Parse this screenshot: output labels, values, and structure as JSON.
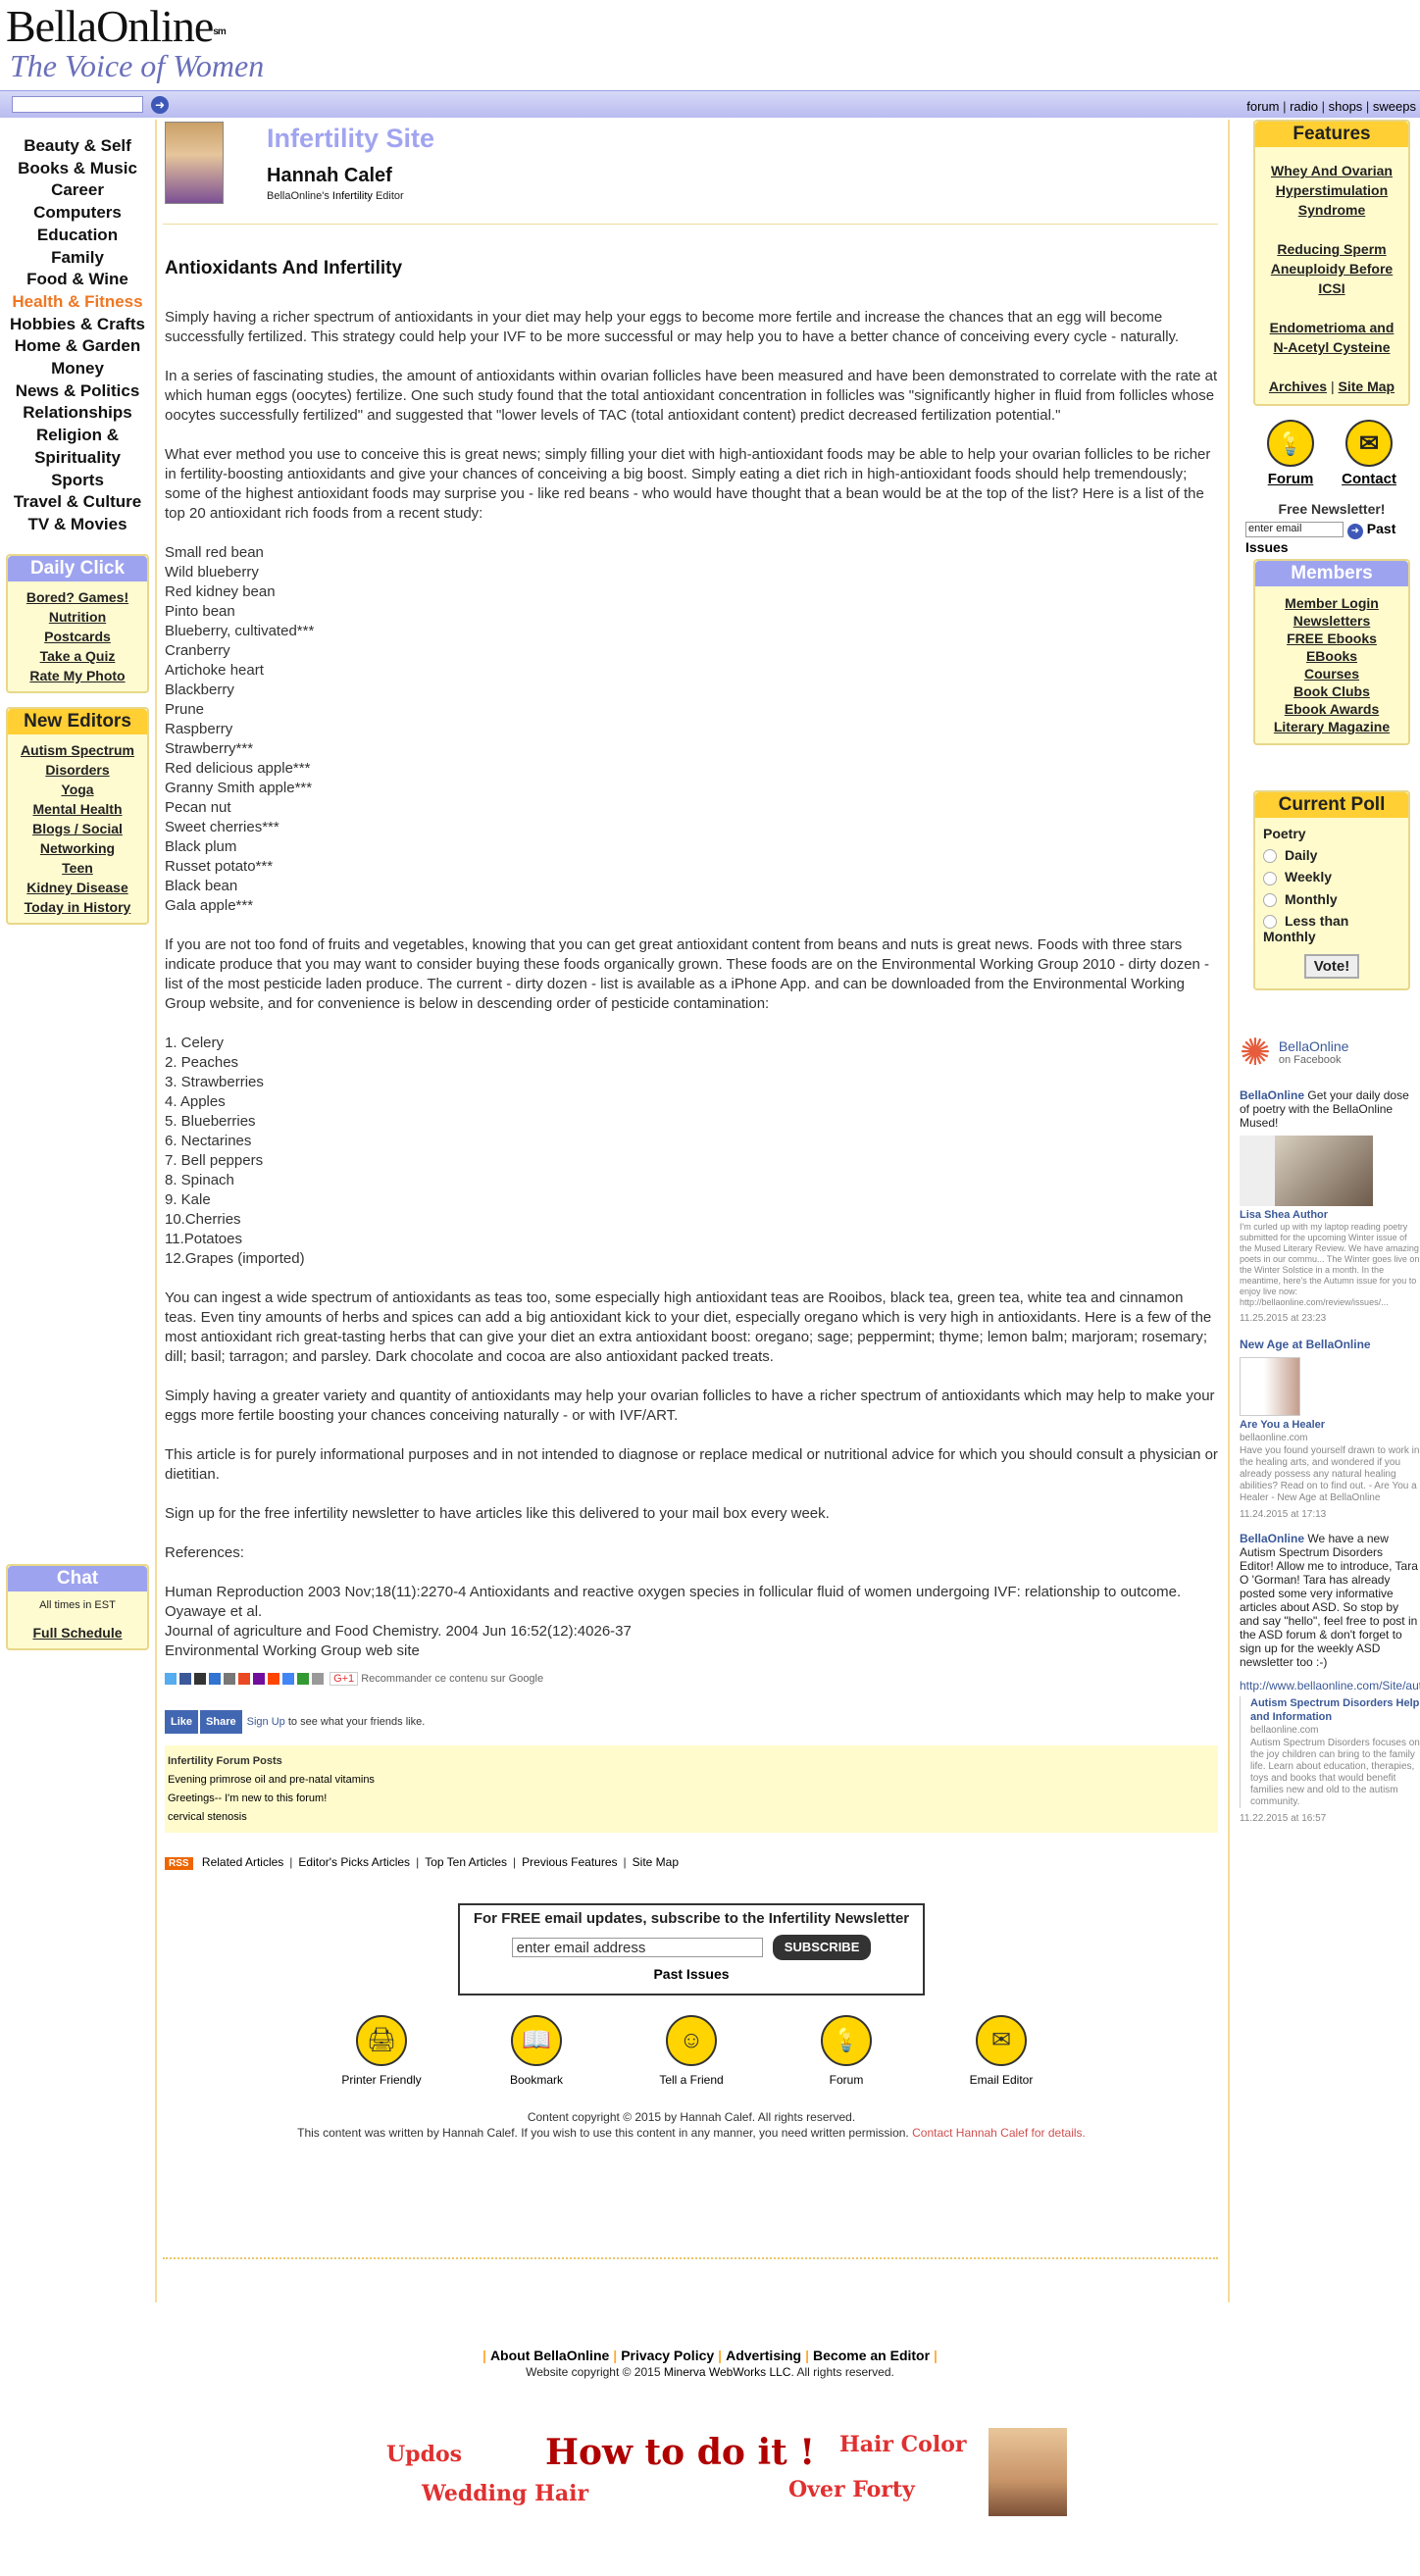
{
  "logo": {
    "name": "BellaOnline",
    "sm": "sm",
    "tagline": "The Voice of Women"
  },
  "topbar": {
    "links": [
      "forum",
      "radio",
      "shops",
      "sweeps"
    ]
  },
  "categories": [
    "Beauty & Self",
    "Books & Music",
    "Career",
    "Computers",
    "Education",
    "Family",
    "Food & Wine",
    "Health & Fitness",
    "Hobbies & Crafts",
    "Home & Garden",
    "Money",
    "News & Politics",
    "Relationships",
    "Religion &",
    "Spirituality",
    "Sports",
    "Travel & Culture",
    "TV & Movies"
  ],
  "daily_click": {
    "title": "Daily Click",
    "items": [
      "Bored? Games!",
      "Nutrition",
      "Postcards",
      "Take a Quiz",
      "Rate My Photo"
    ]
  },
  "new_editors": {
    "title": "New Editors",
    "items": [
      "Autism Spectrum",
      "Disorders",
      "Yoga",
      "Mental Health",
      "Blogs / Social",
      "Networking",
      "Teen",
      "Kidney Disease",
      "Today in History"
    ]
  },
  "chat": {
    "title": "Chat",
    "line": "All times in EST",
    "link": "Full Schedule"
  },
  "header": {
    "site": "Infertility Site",
    "name": "Hannah Calef",
    "ed_pre": "BellaOnline's",
    "ed_link": "Infertility",
    "ed_post": "Editor"
  },
  "article": {
    "title": "Antioxidants And Infertility",
    "p1": "Simply having a richer spectrum of antioxidants in your diet may help your eggs to become more fertile and increase the chances that an egg will become successfully fertilized. This strategy could help your IVF to be more successful or may help you to have a better chance of conceiving every cycle - naturally.",
    "p2": "In a series of fascinating studies, the amount of antioxidants within ovarian follicles have been measured and have been demonstrated to correlate with the rate at which human eggs (oocytes) fertilize. One such study found that the total antioxidant concentration in follicles was \"significantly higher in fluid from follicles whose oocytes successfully fertilized\" and suggested that \"lower levels of TAC (total antioxidant content) predict decreased fertilization potential.\"",
    "p3": "What ever method you use to conceive this is great news; simply filling your diet with high-antioxidant foods may be able to help your ovarian follicles to be richer in fertility-boosting antioxidants and give your chances of conceiving a big boost. Simply eating a diet rich in high-antioxidant foods should help tremendously; some of the highest antioxidant foods may surprise you - like red beans - who would have thought that a bean would be at the top of the list? Here is a list of the top 20 antioxidant rich foods from a recent study:",
    "foods": [
      "Small red bean",
      "Wild blueberry",
      "Red kidney bean",
      "Pinto bean",
      "Blueberry, cultivated***",
      "Cranberry",
      "Artichoke heart",
      "Blackberry",
      "Prune",
      "Raspberry",
      "Strawberry***",
      "Red delicious apple***",
      "Granny Smith apple***",
      "Pecan nut",
      "Sweet cherries***",
      "Black plum",
      "Russet potato***",
      "Black bean",
      "Gala apple***"
    ],
    "p4": "If you are not too fond of fruits and vegetables, knowing that you can get great antioxidant content from beans and nuts is great news. Foods with three stars indicate produce that you may want to consider buying these foods organically grown. These foods are on the Environmental Working Group 2010 - dirty dozen - list of the most pesticide laden produce. The current - dirty dozen - list is available as a iPhone App. and can be downloaded from the Environmental Working Group website, and for convenience is below in descending order of pesticide contamination:",
    "dozen": [
      "1. Celery",
      "2. Peaches",
      "3. Strawberries",
      "4. Apples",
      "5. Blueberries",
      "6. Nectarines",
      "7. Bell peppers",
      "8. Spinach",
      "9. Kale",
      "10.Cherries",
      "11.Potatoes",
      "12.Grapes (imported)"
    ],
    "p5": "You can ingest a wide spectrum of antioxidants as teas too, some especially high antioxidant teas are Rooibos, black tea, green tea, white tea and cinnamon teas. Even tiny amounts of herbs and spices can add a big antioxidant kick to your diet, especially oregano which is very high in antioxidants. Here is a few of the most antioxidant rich great-tasting herbs that can give your diet an extra antioxidant boost: oregano; sage; peppermint; thyme; lemon balm; marjoram; rosemary; dill; basil; tarragon; and parsley. Dark chocolate and cocoa are also antioxidant packed treats.",
    "p6": "Simply having a greater variety and quantity of antioxidants may help your ovarian follicles to have a richer spectrum of antioxidants which may help to make your eggs more fertile boosting your chances conceiving naturally - or with IVF/ART.",
    "p7": "This article is for purely informational purposes and in not intended to diagnose or replace medical or nutritional advice for which you should consult a physician or dietitian.",
    "p8": "Sign up for the free infertility newsletter to have articles like this delivered to your mail box every week.",
    "refs_title": "References:",
    "ref1": "Human Reproduction 2003 Nov;18(11):2270-4 Antioxidants and reactive oxygen species in follicular fluid of women undergoing IVF: relationship to outcome. Oyawaye et al.",
    "ref2": "Journal of agriculture and Food Chemistry. 2004 Jun 16:52(12):4026-37",
    "ref3": "Environmental Working Group web site"
  },
  "social": {
    "gplus": "G+1",
    "recommend": "Recommander ce contenu sur Google",
    "like": "Like",
    "share": "Share",
    "signup": "Sign Up",
    "signup_rest": "to see what your friends like."
  },
  "forum_posts": {
    "title": "Infertility Forum Posts",
    "items": [
      "Evening primrose oil and pre-natal vitamins",
      "Greetings-- I'm new to this forum!",
      "cervical stenosis"
    ]
  },
  "links_row": {
    "rss": "RSS",
    "items": [
      "Related Articles",
      "Editor's Picks Articles",
      "Top Ten Articles",
      "Previous Features",
      "Site Map"
    ]
  },
  "newsletter": {
    "title": "For FREE email updates, subscribe to the Infertility Newsletter",
    "placeholder": "enter email address",
    "button": "SUBSCRIBE",
    "past": "Past Issues"
  },
  "bottom_icons": [
    "Printer Friendly",
    "Bookmark",
    "Tell a Friend",
    "Forum",
    "Email Editor"
  ],
  "copyright": {
    "line1": "Content copyright © 2015 by Hannah Calef. All rights reserved.",
    "line2": "This content was written by Hannah Calef. If you wish to use this content in any manner, you need written permission.",
    "link": "Contact Hannah Calef for details."
  },
  "features": {
    "title": "Features",
    "items": [
      "Whey And Ovarian Hyperstimulation Syndrome",
      "Reducing Sperm Aneuploidy Before ICSI",
      "Endometrioma and N-Acetyl Cysteine"
    ],
    "archives": "Archives",
    "sitemap": "Site Map"
  },
  "right_icons": {
    "forum": "Forum",
    "contact": "Contact"
  },
  "right_newsletter": {
    "title": "Free Newsletter!",
    "placeholder": "enter email",
    "past": "Past Issues"
  },
  "members": {
    "title": "Members",
    "items": [
      "Member Login",
      "Newsletters",
      "FREE Ebooks",
      "EBooks",
      "Courses",
      "Book Clubs",
      "Ebook Awards",
      "Literary Magazine"
    ]
  },
  "poll": {
    "title": "Current Poll",
    "question": "Poetry",
    "options": [
      "Daily",
      "Weekly",
      "Monthly",
      "Less than Monthly"
    ],
    "vote": "Vote!"
  },
  "facebook": {
    "name": "BellaOnline",
    "sub": "on Facebook",
    "post1_name": "BellaOnline",
    "post1_text": "Get your daily dose of poetry with the BellaOnline Mused!",
    "post1_card": "Lisa Shea Author",
    "post1_desc": "I'm curled up with my laptop reading poetry submitted for the upcoming Winter issue of the Mused Literary Review. We have amazing poets in our commu... The Winter goes live on the Winter Solstice in a month. In the meantime, here's the Autumn issue for you to enjoy live now: http://bellaonline.com/review/issues/...",
    "post1_time": "11.25.2015 at 23:23",
    "post2_title": "New Age at BellaOnline",
    "post2_card": "Are You a Healer",
    "post2_domain": "bellaonline.com",
    "post2_desc": "Have you found yourself drawn to work in the healing arts, and wondered if you already possess any natural healing abilities? Read on to find out. - Are You a Healer - New Age at BellaOnline",
    "post2_time": "11.24.2015 at 17:13",
    "post3_name": "BellaOnline",
    "post3_text": "We have a new Autism Spectrum Disorders Editor! Allow me to introduce, Tara O 'Gorman! Tara has already posted some very informative articles about ASD. So stop by and say \"hello\", feel free to post in the ASD forum & don't forget to sign up for the weekly ASD newsletter too :-)",
    "post3_url": "http://www.bellaonline.com/Site/autism",
    "post3_card": "Autism Spectrum Disorders Help and Information",
    "post3_domain": "bellaonline.com",
    "post3_desc": "Autism Spectrum Disorders focuses on the joy children can bring to the family life. Learn about education, therapies, toys and books that would benefit families new and old to the autism community.",
    "post3_time": "11.22.2015 at 16:57"
  },
  "footer": {
    "links": [
      "About BellaOnline",
      "Privacy Policy",
      "Advertising",
      "Become an Editor"
    ],
    "copy_pre": "Website copyright © 2015",
    "copy_link": "Minerva WebWorks LLC",
    "copy_post": ". All rights reserved."
  },
  "ad": {
    "a": "Updos",
    "b": "How to do it !",
    "c": "Hair Color",
    "d": "Wedding Hair",
    "e": "Over Forty"
  }
}
